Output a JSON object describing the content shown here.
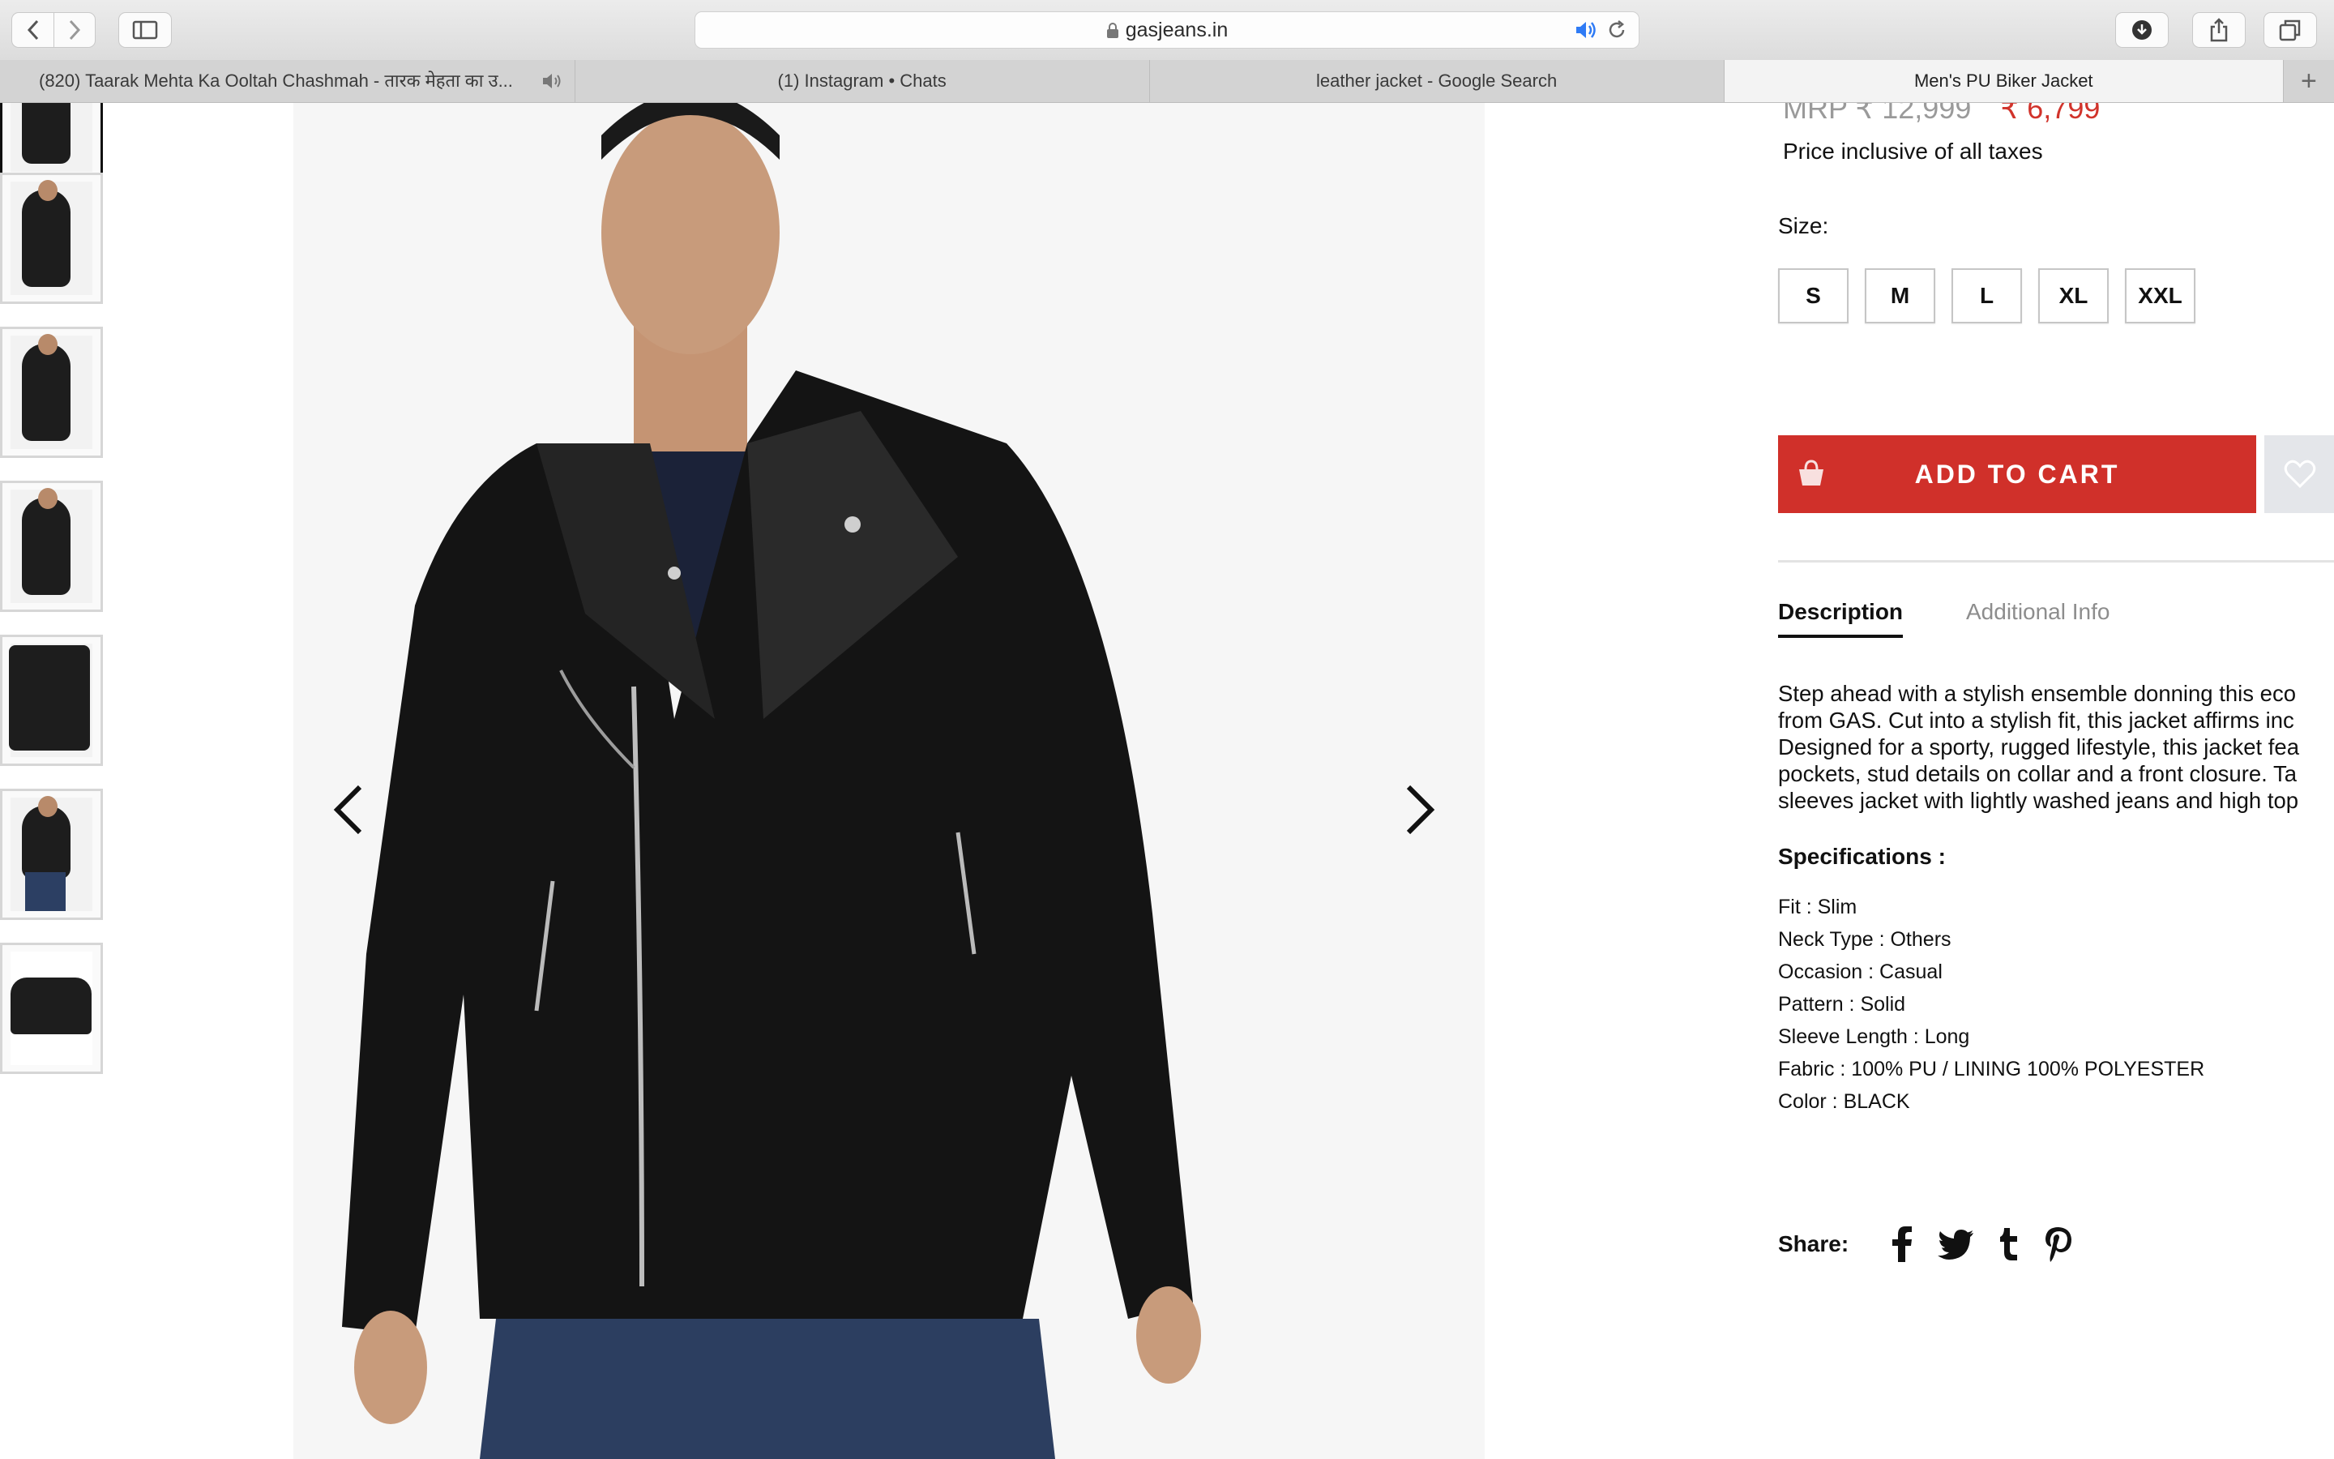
{
  "browser": {
    "url": "gasjeans.in",
    "tabs": [
      {
        "label": "(820) Taarak Mehta Ka Ooltah Chashmah - तारक मेहता का उ..."
      },
      {
        "label": "(1) Instagram • Chats"
      },
      {
        "label": "leather jacket - Google Search"
      },
      {
        "label": "Men's PU Biker Jacket"
      }
    ],
    "new_tab_label": "+"
  },
  "product": {
    "mrp_text": "MRP ₹ 12,999",
    "sale_price": "₹ 6,799",
    "tax_note": "Price inclusive of all taxes",
    "size_label": "Size:",
    "sizes": [
      "S",
      "M",
      "L",
      "XL",
      "XXL"
    ],
    "add_to_cart": "ADD TO CART",
    "tabs": {
      "description": "Description",
      "additional_info": "Additional Info"
    },
    "description_lines": [
      "Step ahead with a stylish ensemble donning this eco",
      "from GAS. Cut into a stylish fit, this jacket affirms inc",
      "Designed for a sporty, rugged lifestyle, this jacket fea",
      "pockets, stud details on collar and a front closure. Ta",
      "sleeves jacket with lightly washed jeans and high top"
    ],
    "specifications_title": "Specifications :",
    "specifications": [
      "Fit : Slim",
      "Neck Type : Others",
      "Occasion : Casual",
      "Pattern : Solid",
      "Sleeve Length : Long",
      "Fabric : 100% PU / LINING 100% POLYESTER",
      "Color : BLACK"
    ],
    "share_label": "Share:",
    "share_icons": [
      "facebook-icon",
      "twitter-icon",
      "tumblr-icon",
      "pinterest-icon"
    ]
  },
  "colors": {
    "accent": "#d0302a",
    "text": "#111111",
    "muted": "#8d8d8d"
  }
}
